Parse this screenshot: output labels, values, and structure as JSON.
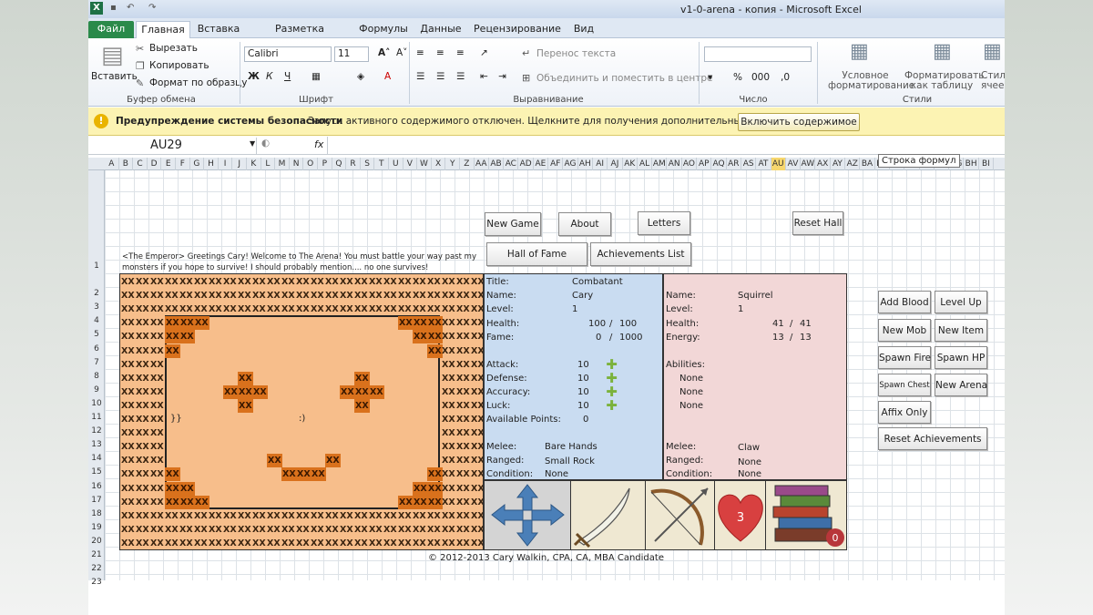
{
  "window": {
    "title": "v1-0-arena - копия  -  Microsoft Excel"
  },
  "tabs": [
    "Файл",
    "Главная",
    "Вставка",
    "Разметка страницы",
    "Формулы",
    "Данные",
    "Рецензирование",
    "Вид"
  ],
  "ribbon": {
    "paste": "Вставить",
    "cut": "Вырезать",
    "copy": "Копировать",
    "format_painter": "Формат по образцу",
    "clipboard": "Буфер обмена",
    "font_name": "Calibri",
    "font_size": "11",
    "font_group": "Шрифт",
    "wrap": "Перенос текста",
    "merge": "Объединить и поместить в центре",
    "align_group": "Выравнивание",
    "number_group": "Число",
    "cond_format": "Условное форматирование",
    "format_table": "Форматировать как таблицу",
    "styles": "Стили ячеек",
    "styles_group": "Стили"
  },
  "warning": {
    "title": "Предупреждение системы безопасности",
    "text": "Запуск активного содержимого отключен. Щелкните для получения дополнительных сведений.",
    "button": "Включить содержимое"
  },
  "formula_bar": {
    "name_box": "AU29",
    "fx": "fx",
    "tooltip": "Строка формул"
  },
  "columns": [
    "A",
    "B",
    "C",
    "D",
    "E",
    "F",
    "G",
    "H",
    "I",
    "J",
    "K",
    "L",
    "M",
    "N",
    "O",
    "P",
    "Q",
    "R",
    "S",
    "T",
    "U",
    "V",
    "W",
    "X",
    "Y",
    "Z",
    "AA",
    "AB",
    "AC",
    "AD",
    "AE",
    "AF",
    "AG",
    "AH",
    "AI",
    "AJ",
    "AK",
    "AL",
    "AM",
    "AN",
    "AO",
    "AP",
    "AQ",
    "AR",
    "AS",
    "AT",
    "AU",
    "AV",
    "AW",
    "AX",
    "AY",
    "AZ",
    "BA",
    "BB",
    "BC",
    "BD",
    "BE",
    "BF",
    "BG",
    "BH",
    "BI"
  ],
  "rows": [
    "1",
    "2",
    "3",
    "4",
    "5",
    "6",
    "7",
    "8",
    "9",
    "10",
    "11",
    "12",
    "13",
    "14",
    "15",
    "16",
    "17",
    "18",
    "19",
    "20",
    "21",
    "22",
    "23"
  ],
  "buttons": {
    "new_game": "New Game",
    "about": "About",
    "letters": "Letters",
    "reset_hall": "Reset Hall",
    "hall_of_fame": "Hall of Fame",
    "achievements": "Achievements List",
    "add_blood": "Add Blood",
    "level_up": "Level Up",
    "new_mob": "New Mob",
    "new_item": "New Item",
    "spawn_fire": "Spawn Fire",
    "spawn_hp": "Spawn HP",
    "spawn_chest": "Spawn Chest",
    "new_arena": "New Arena",
    "affix_only": "Affix Only",
    "reset_ach": "Reset Achievements"
  },
  "greeting": "<The Emperor> Greetings Cary! Welcome to The Arena! You must battle your way past my monsters if you hope to survive! I should probably mention.... no one survives!",
  "arena": {
    "cell": "XX",
    "left_face": "}}",
    "right_face": ":)"
  },
  "player": {
    "title_l": "Title:",
    "title": "Combatant",
    "name_l": "Name:",
    "name": "Cary",
    "level_l": "Level:",
    "level": "1",
    "health_l": "Health:",
    "health": "100",
    "health_max": "100",
    "fame_l": "Fame:",
    "fame": "0",
    "fame_max": "1000",
    "slash": "/",
    "attack_l": "Attack:",
    "attack": "10",
    "defense_l": "Defense:",
    "defense": "10",
    "accuracy_l": "Accuracy:",
    "accuracy": "10",
    "luck_l": "Luck:",
    "luck": "10",
    "points_l": "Available Points:",
    "points": "0",
    "melee_l": "Melee:",
    "melee": "Bare Hands",
    "ranged_l": "Ranged:",
    "ranged": "Small Rock",
    "cond_l": "Condition:",
    "cond": "None"
  },
  "mob": {
    "name_l": "Name:",
    "name": "Squirrel",
    "level_l": "Level:",
    "level": "1",
    "health_l": "Health:",
    "health": "41",
    "health_max": "41",
    "energy_l": "Energy:",
    "energy": "13",
    "energy_max": "13",
    "abilities_l": "Abilities:",
    "ab1": "None",
    "ab2": "None",
    "ab3": "None",
    "melee_l": "Melee:",
    "melee": "Claw",
    "ranged_l": "Ranged:",
    "ranged": "None",
    "cond_l": "Condition:",
    "cond": "None"
  },
  "icons": {
    "hearts": "3",
    "books": "0"
  },
  "copyright": "© 2012-2013 Cary Walkin, CPA, CA, MBA Candidate",
  "colors": {
    "arena": "#f7be8b",
    "wall": "#d9711c",
    "player_panel": "#c9dcf1",
    "mob_panel": "#f2d7d7",
    "file_tab": "#2a8a4a"
  }
}
